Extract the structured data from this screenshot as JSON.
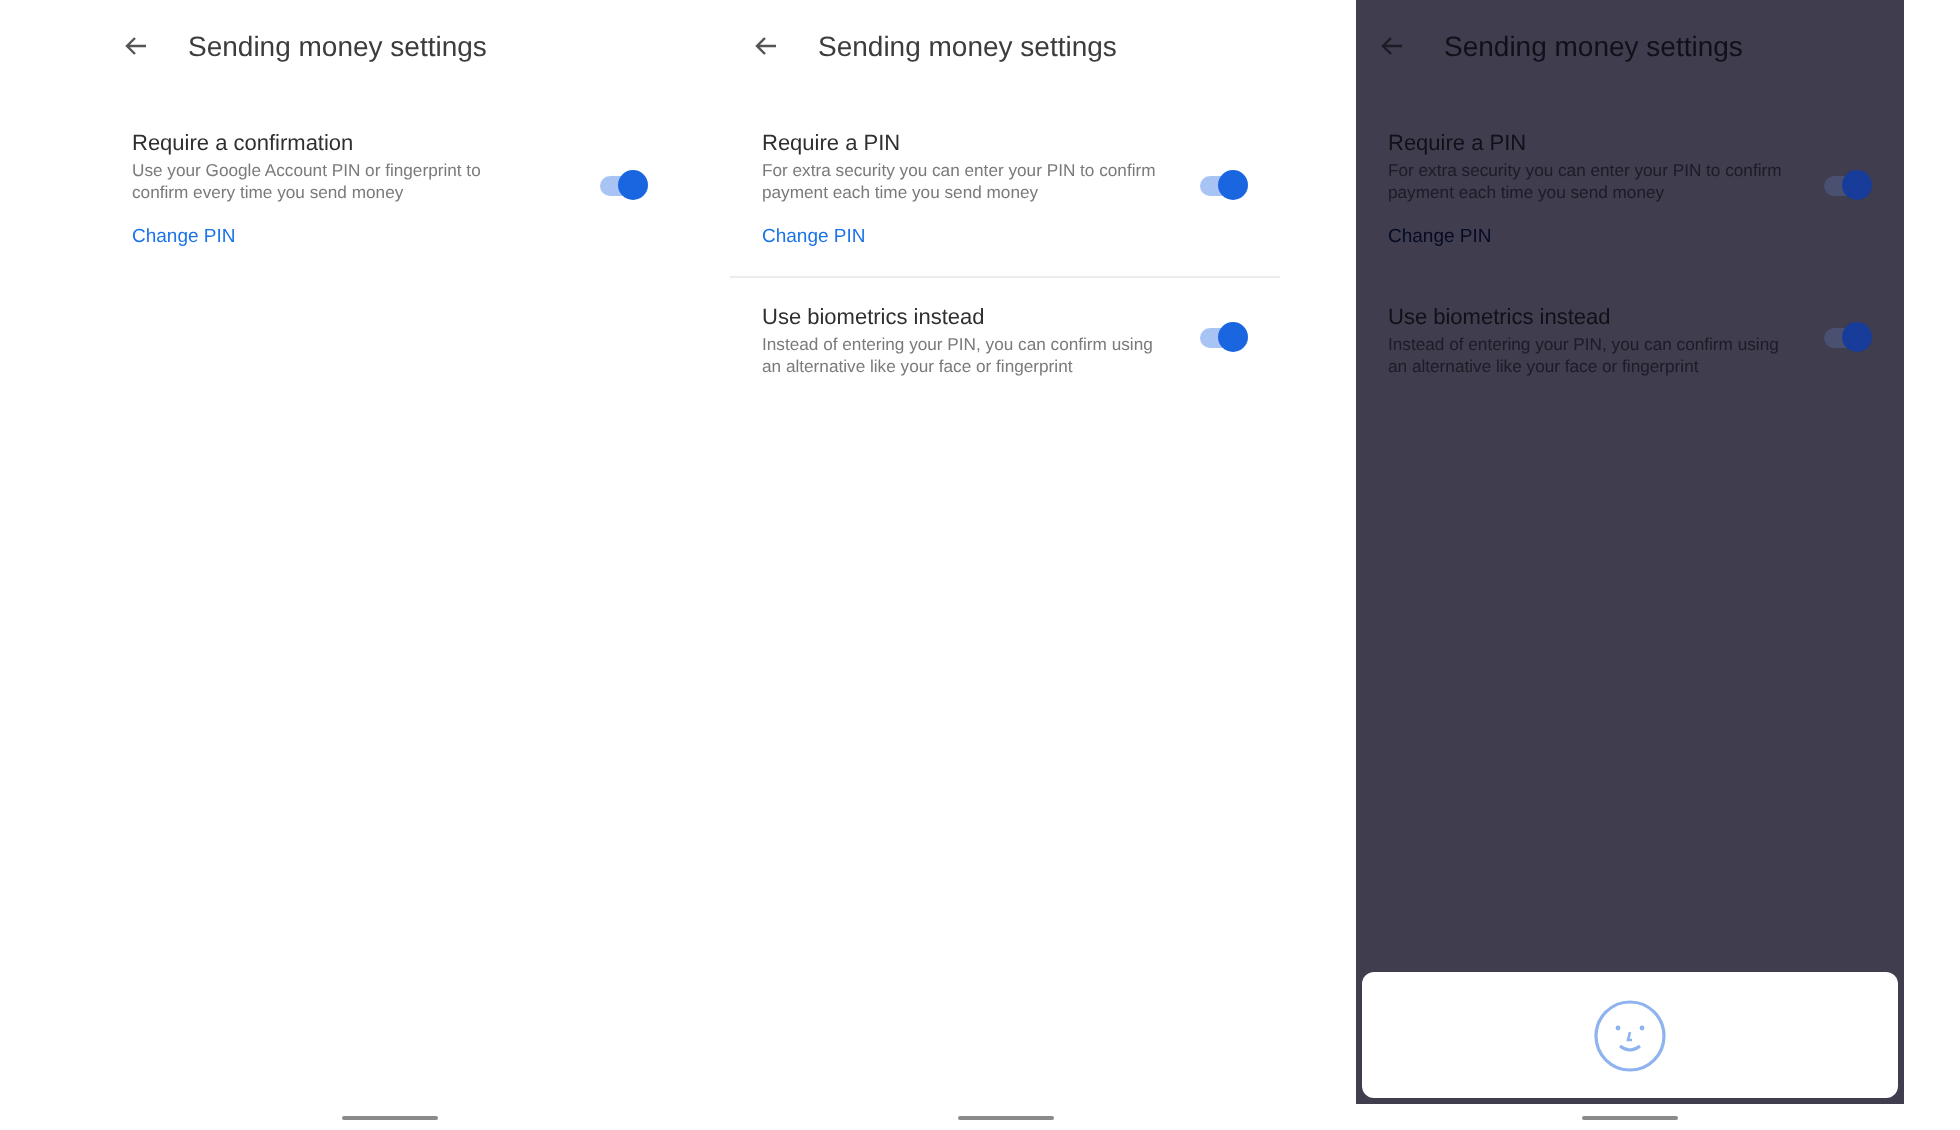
{
  "screens": [
    {
      "title": "Sending money settings",
      "dimmed": false,
      "settings": [
        {
          "title": "Require a confirmation",
          "description": "Use your Google Account PIN or fingerprint to confirm every time you send money",
          "link": "Change PIN",
          "on": true
        }
      ]
    },
    {
      "title": "Sending money settings",
      "dimmed": false,
      "settings": [
        {
          "title": "Require a PIN",
          "description": "For extra security you can enter your PIN to confirm payment each time you send money",
          "link": "Change PIN",
          "on": true
        },
        {
          "title": "Use biometrics instead",
          "description": "Instead of entering your PIN, you can confirm using an alternative like your face or fingerprint",
          "on": true
        }
      ]
    },
    {
      "title": "Sending money settings",
      "dimmed": true,
      "settings": [
        {
          "title": "Require a PIN",
          "description": "For extra security you can enter your PIN to confirm payment each time you send money",
          "link": "Change PIN",
          "on": true
        },
        {
          "title": "Use biometrics instead",
          "description": "Instead of entering your PIN, you can confirm using an alternative like your face or fingerprint",
          "on": true
        }
      ],
      "sheet": {
        "kind": "face"
      }
    }
  ]
}
